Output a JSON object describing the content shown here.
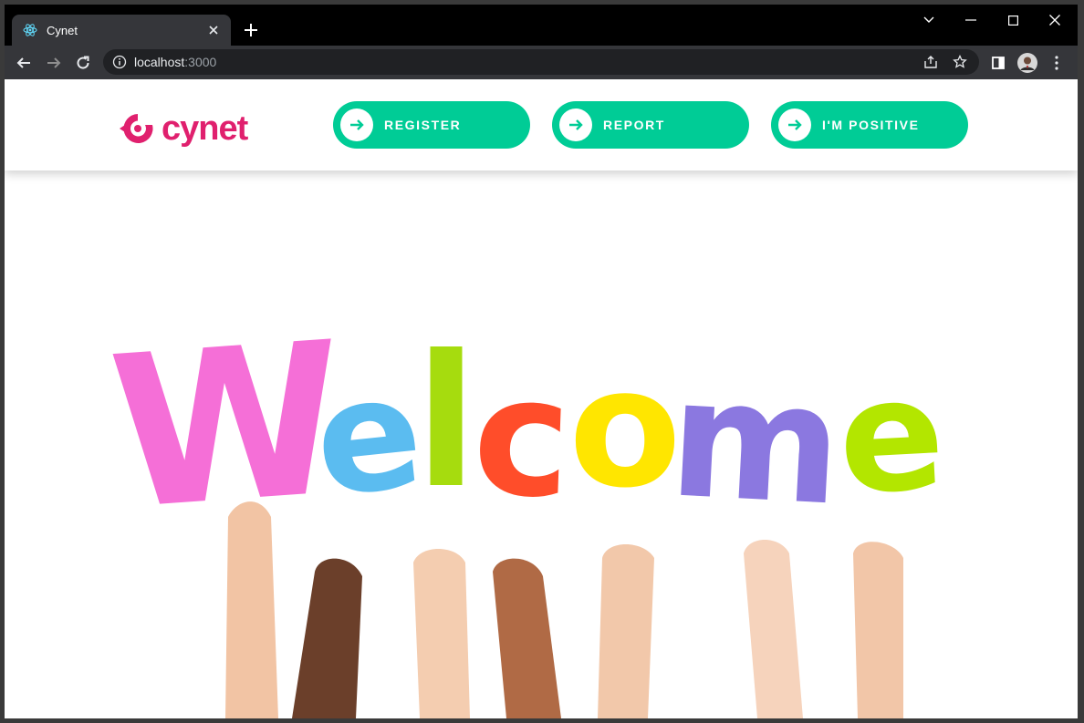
{
  "browser": {
    "tab_title": "Cynet",
    "url_host": "localhost",
    "url_port": ":3000"
  },
  "header": {
    "logo_text": "cynet",
    "nav": [
      {
        "label": "REGISTER",
        "icon": "arrow-right-icon"
      },
      {
        "label": "REPORT",
        "icon": "arrow-right-icon"
      },
      {
        "label": "I'M POSITIVE",
        "icon": "arrow-right-icon"
      }
    ]
  },
  "hero": {
    "letters": [
      "W",
      "e",
      "l",
      "c",
      "o",
      "m",
      "e"
    ],
    "letter_colors": [
      "#f56fd7",
      "#5bbcf0",
      "#a6dc0e",
      "#ff4d2a",
      "#ffe600",
      "#8b78e0",
      "#b3e600"
    ]
  },
  "colors": {
    "accent": "#00cc96",
    "brand": "#e0206e"
  }
}
